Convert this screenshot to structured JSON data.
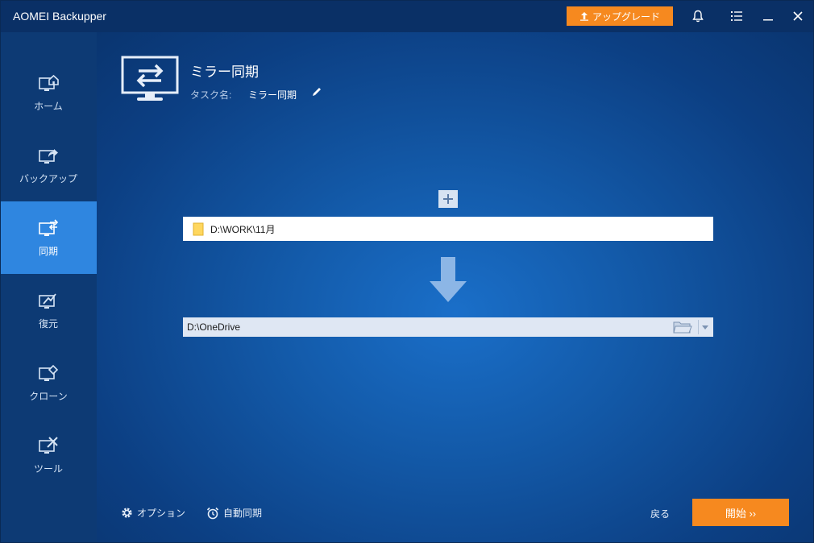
{
  "app": {
    "title": "AOMEI Backupper"
  },
  "titlebar": {
    "upgrade_label": "アップグレード",
    "icons": [
      "bell-icon",
      "menu-icon",
      "minimize-icon",
      "close-icon"
    ]
  },
  "sidebar": {
    "items": [
      {
        "label": "ホーム",
        "icon": "home-icon"
      },
      {
        "label": "バックアップ",
        "icon": "backup-icon"
      },
      {
        "label": "同期",
        "icon": "sync-icon",
        "active": true
      },
      {
        "label": "復元",
        "icon": "restore-icon"
      },
      {
        "label": "クローン",
        "icon": "clone-icon"
      },
      {
        "label": "ツール",
        "icon": "tools-icon"
      }
    ]
  },
  "main": {
    "title": "ミラー同期",
    "task_name_label": "タスク名:",
    "task_name_value": "ミラー同期",
    "source_path": "D:\\WORK\\11月",
    "dest_path": "D:\\OneDrive"
  },
  "footer": {
    "options_label": "オプション",
    "auto_sync_label": "自動同期",
    "back_label": "戻る",
    "start_label": "開始 ››"
  },
  "colors": {
    "accent": "#f6891f",
    "active_nav": "#2f86e0",
    "sidebar_bg": "#0d3a74",
    "titlebar_bg": "#0a3066"
  }
}
